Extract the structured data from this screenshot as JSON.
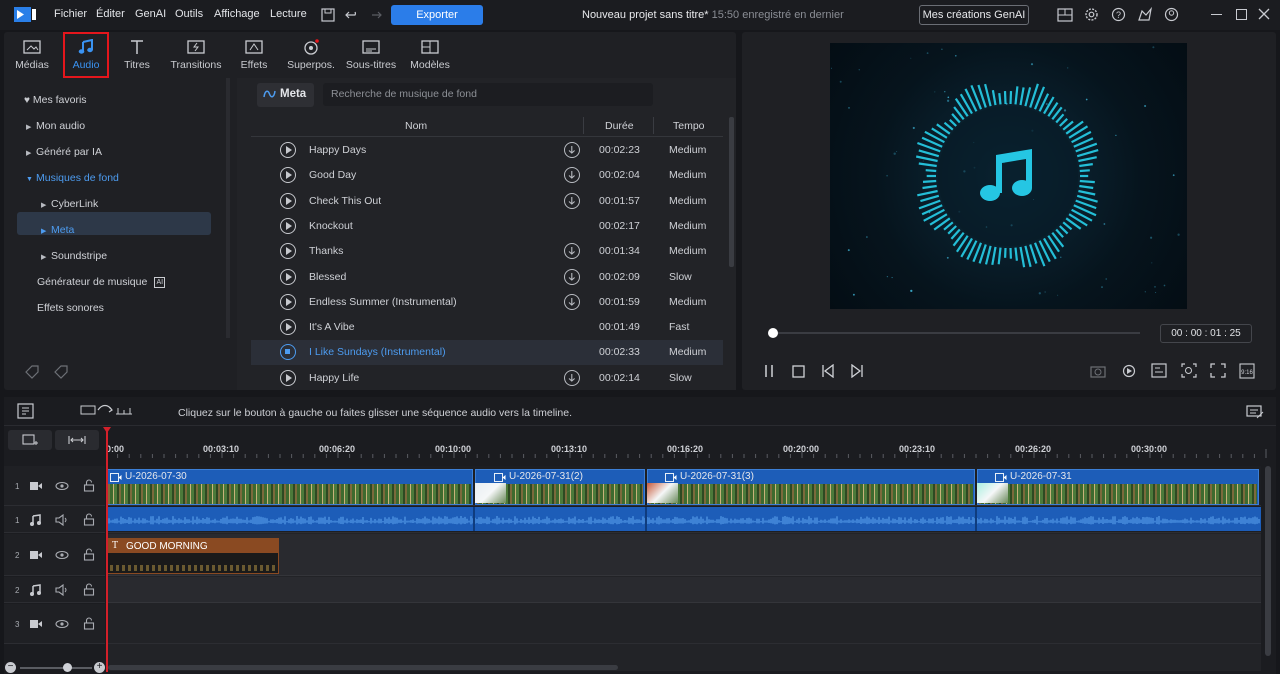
{
  "titlebar": {
    "menu": [
      "Fichier",
      "Éditer",
      "GenAI",
      "Outils",
      "Affichage",
      "Lecture"
    ],
    "export_label": "Exporter",
    "project_title": "Nouveau projet sans titre*",
    "save_status": "15:50 enregistré en dernier",
    "genai_button": "Mes créations GenAI"
  },
  "library": {
    "tabs": [
      {
        "label": "Médias",
        "icon": "media-icon"
      },
      {
        "label": "Audio",
        "icon": "music-note-icon",
        "active": true
      },
      {
        "label": "Titres",
        "icon": "title-icon"
      },
      {
        "label": "Transitions",
        "icon": "transition-icon"
      },
      {
        "label": "Effets",
        "icon": "effects-icon"
      },
      {
        "label": "Superpos.",
        "icon": "overlay-icon"
      },
      {
        "label": "Sous-titres",
        "icon": "subtitles-icon"
      },
      {
        "label": "Modèles",
        "icon": "templates-icon"
      }
    ],
    "sidebar": {
      "favorites": "Mes favoris",
      "my_audio": "Mon audio",
      "ai_generated": "Généré par IA",
      "background_music": "Musiques de fond",
      "cyberlink": "CyberLink",
      "meta": "Meta",
      "soundstripe": "Soundstripe",
      "music_generator": "Générateur de musique",
      "sound_effects": "Effets sonores"
    },
    "source_chip": "Meta",
    "search_placeholder": "Recherche de musique de fond",
    "columns": {
      "name": "Nom",
      "duration": "Durée",
      "tempo": "Tempo"
    },
    "tracks": [
      {
        "name": "Happy Days",
        "duration": "00:02:23",
        "tempo": "Medium",
        "download": true
      },
      {
        "name": "Good Day",
        "duration": "00:02:04",
        "tempo": "Medium",
        "download": true
      },
      {
        "name": "Check This Out",
        "duration": "00:01:57",
        "tempo": "Medium",
        "download": true
      },
      {
        "name": "Knockout",
        "duration": "00:02:17",
        "tempo": "Medium",
        "download": false
      },
      {
        "name": "Thanks",
        "duration": "00:01:34",
        "tempo": "Medium",
        "download": true
      },
      {
        "name": "Blessed",
        "duration": "00:02:09",
        "tempo": "Slow",
        "download": true
      },
      {
        "name": "Endless Summer (Instrumental)",
        "duration": "00:01:59",
        "tempo": "Medium",
        "download": true
      },
      {
        "name": "It's A Vibe",
        "duration": "00:01:49",
        "tempo": "Fast",
        "download": false
      },
      {
        "name": "I Like Sundays (Instrumental)",
        "duration": "00:02:33",
        "tempo": "Medium",
        "download": false,
        "selected": true
      },
      {
        "name": "Happy Life",
        "duration": "00:02:14",
        "tempo": "Slow",
        "download": true
      }
    ]
  },
  "preview": {
    "timecode": "00 : 00 : 01 : 25"
  },
  "timeline": {
    "hint": "Cliquez sur le bouton à gauche ou faites glisser une séquence audio vers la timeline.",
    "ruler": [
      "0:00",
      "00:03:10",
      "00:06:20",
      "00:10:00",
      "00:13:10",
      "00:16:20",
      "00:20:00",
      "00:23:10",
      "00:26:20",
      "00:30:00"
    ],
    "track_numbers": [
      "1",
      "1",
      "2",
      "2",
      "3"
    ],
    "clips": [
      "U-2026-07-30",
      "U-2026-07-31(2)",
      "U-2026-07-31(3)",
      "U-2026-07-31"
    ],
    "title_clip": "GOOD MORNING"
  },
  "colors": {
    "accent": "#2b7de9",
    "selected_text": "#4d9cf0",
    "highlight_box": "#e4161c",
    "clip_blue": "#1d5db8",
    "title_clip": "#8a4a22"
  }
}
